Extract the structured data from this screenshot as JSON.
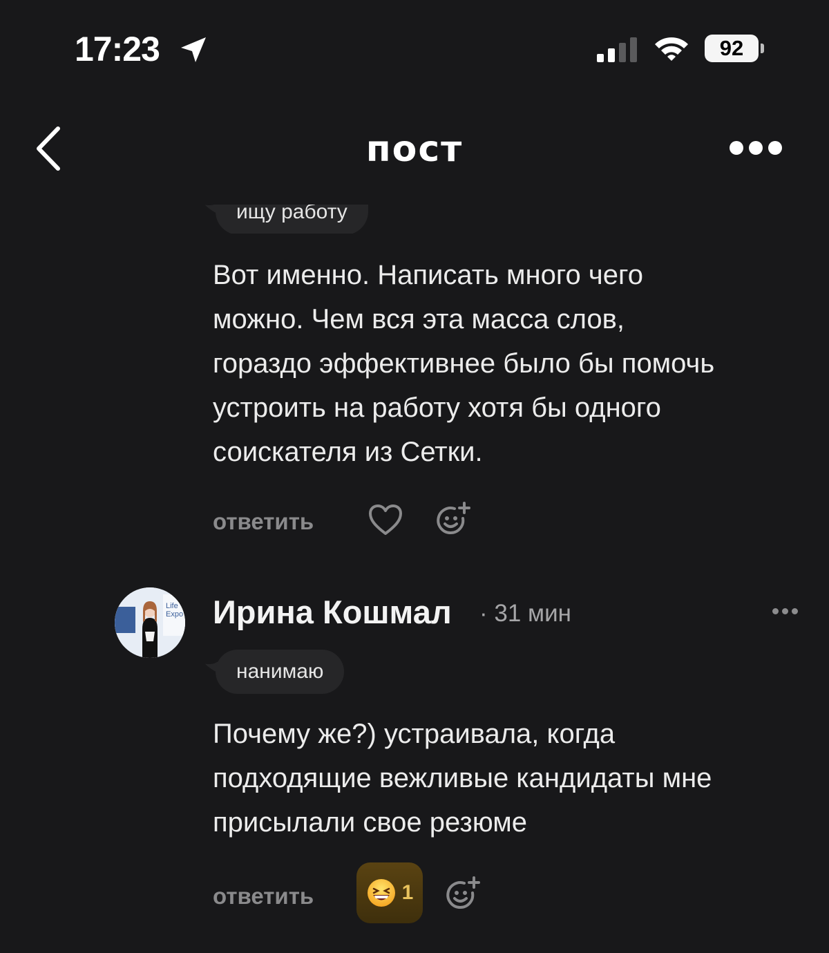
{
  "status_bar": {
    "time": "17:23",
    "battery": "92"
  },
  "nav": {
    "title": "пост",
    "back_icon": "chevron-left-icon",
    "more_icon": "more-horizontal-icon"
  },
  "comments": [
    {
      "tag": "ищу работу",
      "text_lines": [
        "Вот именно. Написать много чего",
        "можно. Чем вся эта масса слов,",
        "гораздо эффективнее было бы помочь",
        "устроить на работу хотя бы одного",
        "соискателя из Сетки."
      ],
      "reply_label": "ответить"
    },
    {
      "author": "Ирина Кошмал",
      "time": "· 31 мин",
      "tag": "нанимаю",
      "text_lines": [
        "Почему же?) устраивала, когда",
        "подходящие вежливые кандидаты мне",
        "присылали свое резюме"
      ],
      "reply_label": "ответить",
      "reaction": {
        "emoji": "grinning-squinting-face",
        "count": "1"
      },
      "avatar_text": [
        "Life",
        "Expo"
      ]
    }
  ],
  "colors": {
    "background": "#18181a",
    "tag_background": "#262628",
    "muted": "#8a8a8c",
    "reaction_accent": "#e9c35d"
  }
}
